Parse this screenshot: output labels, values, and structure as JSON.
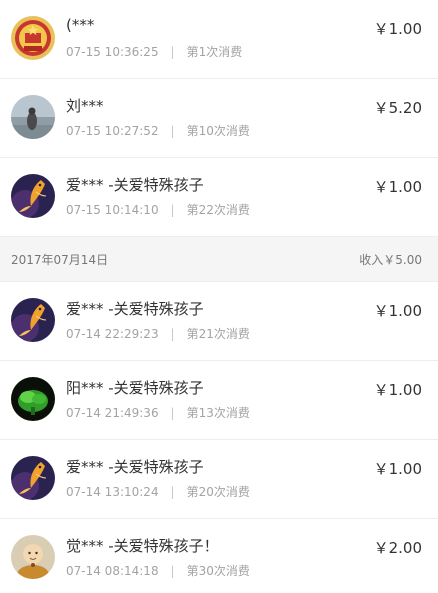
{
  "group_header": {
    "date": "2017年07月14日",
    "income": "收入￥5.00"
  },
  "rows_top": [
    {
      "name": "(***",
      "time": "07-15 10:36:25",
      "count": "第1次消费",
      "amount": "￥1.00",
      "avatar": "emblem-avatar"
    },
    {
      "name": "刘***",
      "time": "07-15 10:27:52",
      "count": "第10次消费",
      "amount": "￥5.20",
      "avatar": "seaside-photo-avatar"
    },
    {
      "name": "爱*** -关爱特殊孩子",
      "time": "07-15 10:14:10",
      "count": "第22次消费",
      "amount": "￥1.00",
      "avatar": "koi-fish-avatar"
    }
  ],
  "rows_bottom": [
    {
      "name": "爱*** -关爱特殊孩子",
      "time": "07-14 22:29:23",
      "count": "第21次消费",
      "amount": "￥1.00",
      "avatar": "koi-fish-avatar"
    },
    {
      "name": "阳*** -关爱特殊孩子",
      "time": "07-14 21:49:36",
      "count": "第13次消费",
      "amount": "￥1.00",
      "avatar": "green-plant-avatar"
    },
    {
      "name": "爱*** -关爱特殊孩子",
      "time": "07-14 13:10:24",
      "count": "第20次消费",
      "amount": "￥1.00",
      "avatar": "koi-fish-avatar"
    },
    {
      "name": "觉*** -关爱特殊孩子！",
      "time": "07-14 08:14:18",
      "count": "第30次消费",
      "amount": "￥2.00",
      "avatar": "monk-figure-avatar"
    }
  ],
  "meta_separator": "|"
}
